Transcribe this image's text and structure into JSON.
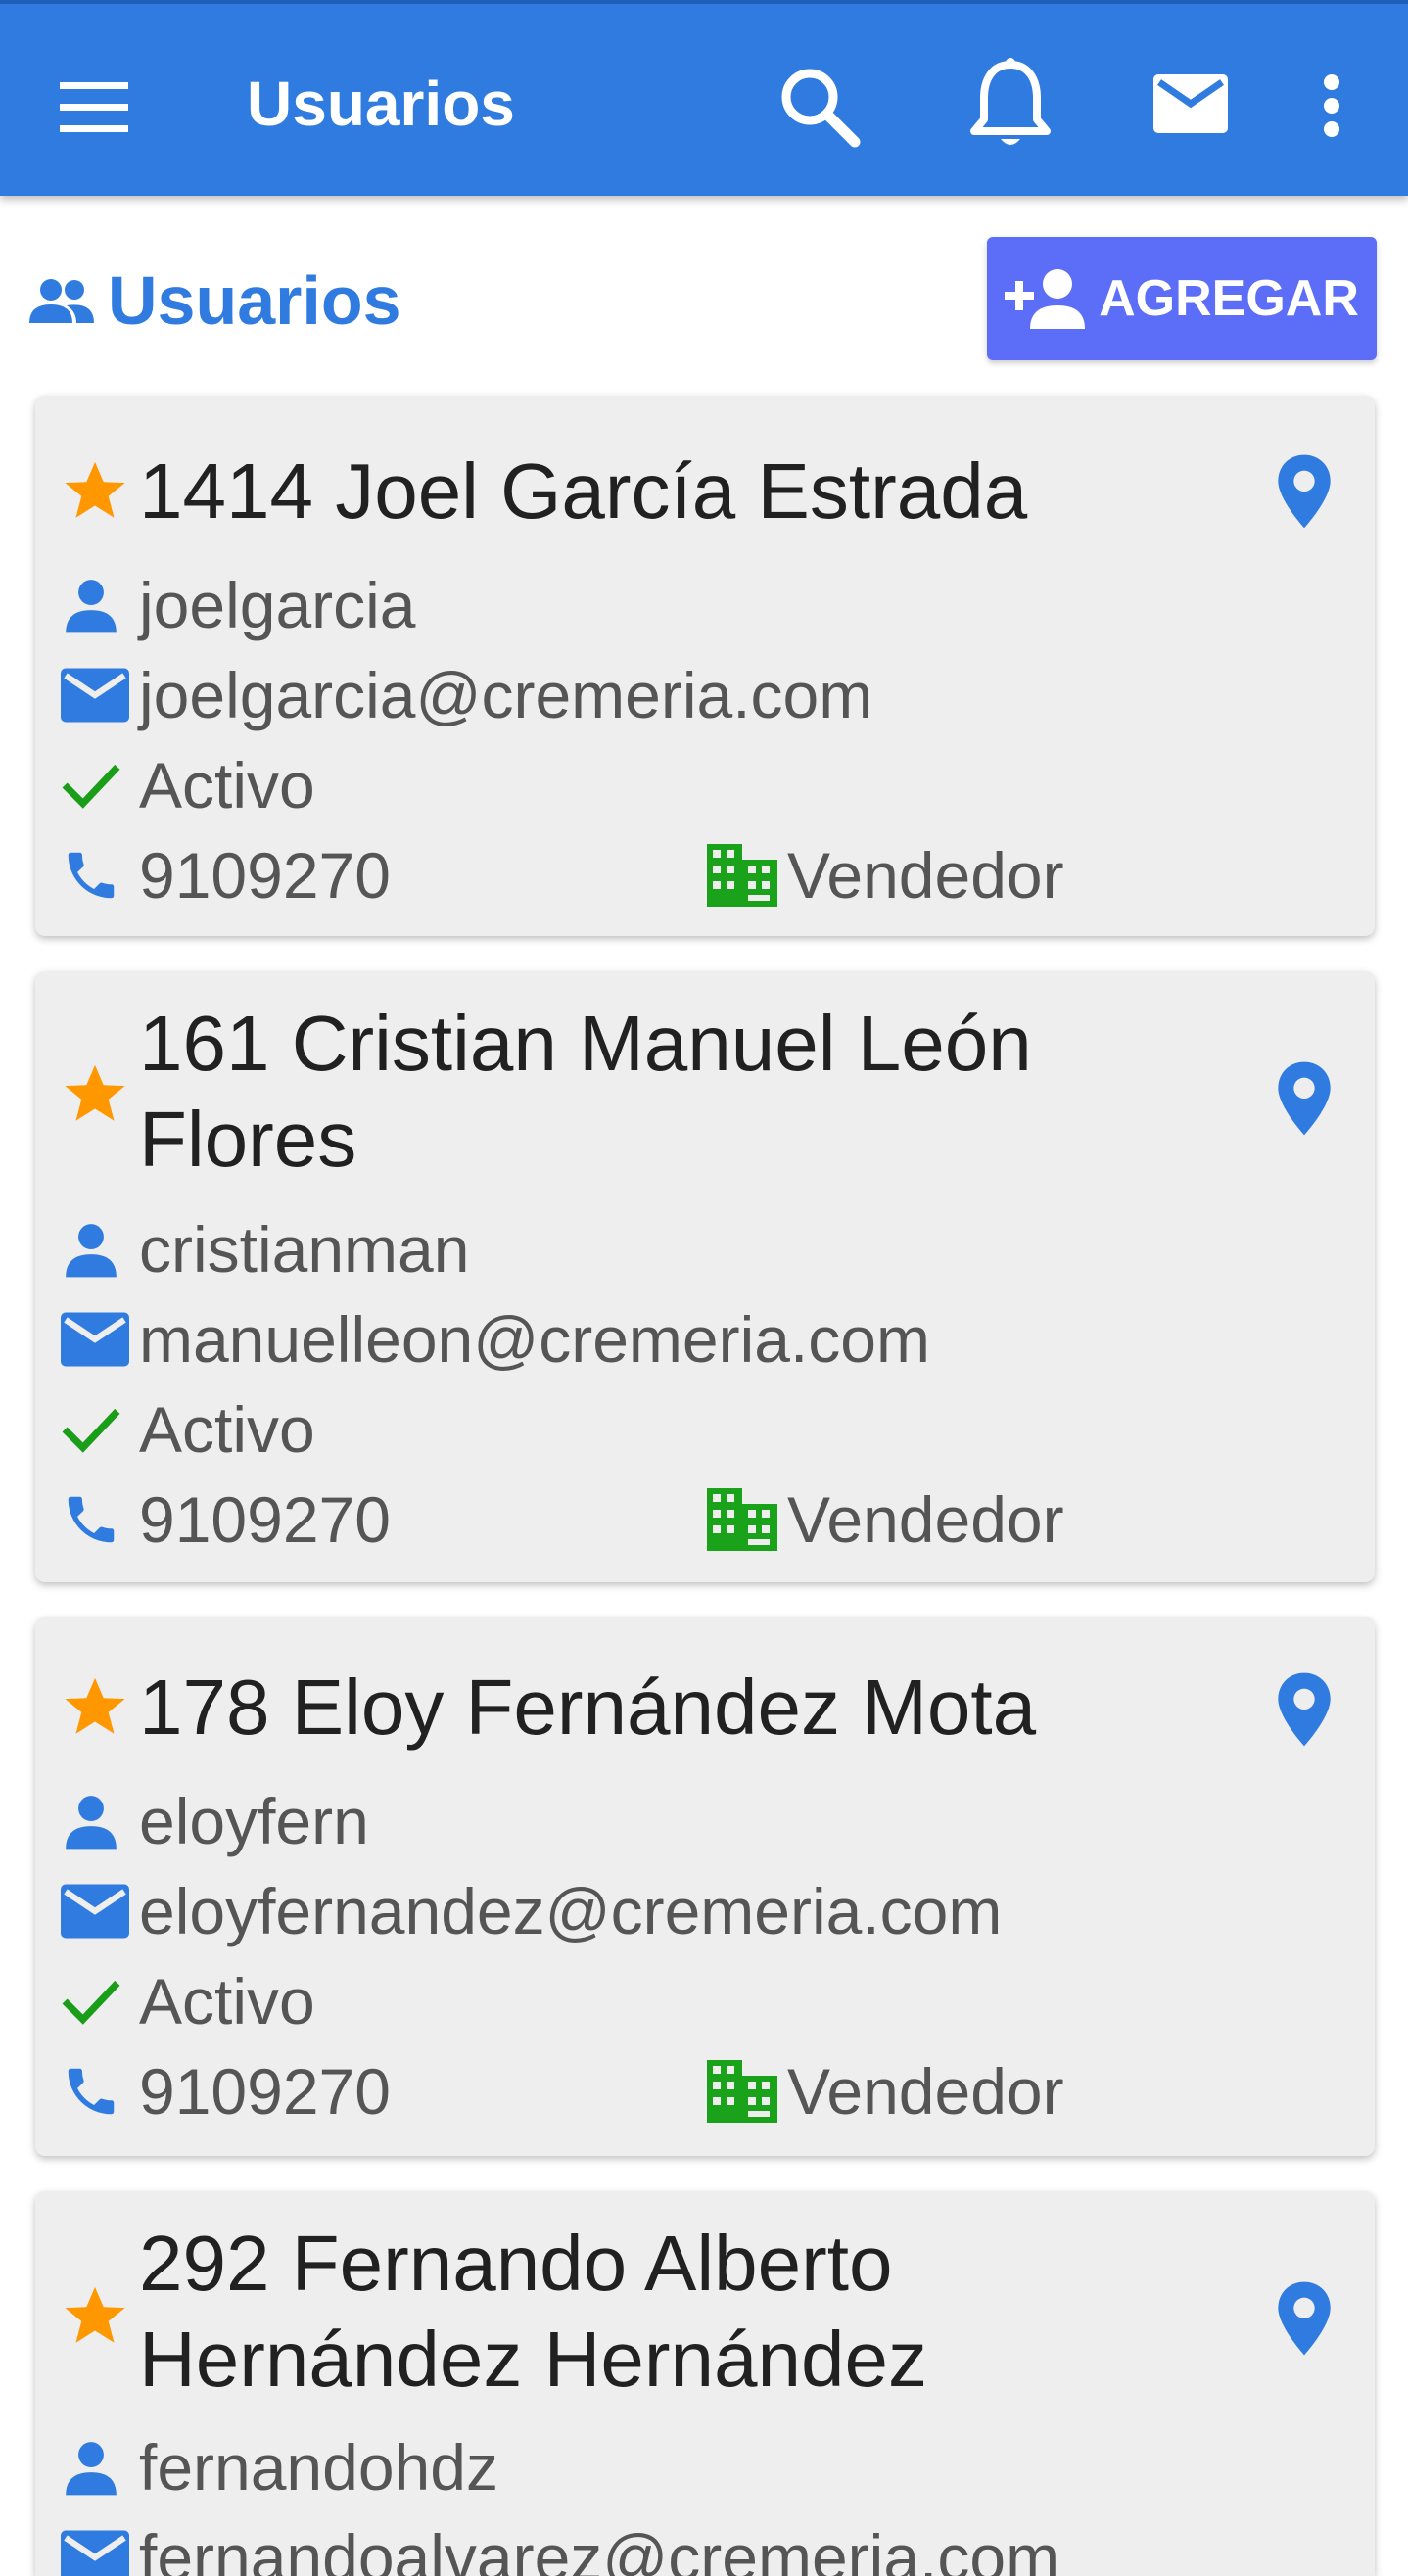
{
  "appbar": {
    "title": "Usuarios",
    "background": "#2f7be0",
    "icons": [
      "menu-icon",
      "search-icon",
      "bell-icon",
      "mail-icon",
      "more-vert-icon"
    ]
  },
  "section": {
    "title": "Usuarios",
    "icon": "people-icon",
    "add_button_label": "AGREGAR",
    "add_button_color": "#5c6ef7"
  },
  "users": [
    {
      "name": "1414 Joel García Estrada",
      "username": "joelgarcia",
      "email": "joelgarcia@cremeria.com",
      "status": "Activo",
      "phone": "9109270",
      "role": "Vendedor"
    },
    {
      "name": "161 Cristian Manuel León Flores",
      "username": "cristianman",
      "email": "manuelleon@cremeria.com",
      "status": "Activo",
      "phone": "9109270",
      "role": "Vendedor"
    },
    {
      "name": "178 Eloy Fernández Mota",
      "username": "eloyfern",
      "email": "eloyfernandez@cremeria.com",
      "status": "Activo",
      "phone": "9109270",
      "role": "Vendedor"
    },
    {
      "name": "292 Fernando Alberto Hernández Hernández",
      "username": "fernandohdz",
      "email": "fernandoalvarez@cremeria.com",
      "status": "",
      "phone": "",
      "role": ""
    }
  ],
  "colors": {
    "star": "#ff9800",
    "accent_blue": "#2f7be0",
    "status_green": "#1a9e1a",
    "role_green": "#1aa31a"
  }
}
